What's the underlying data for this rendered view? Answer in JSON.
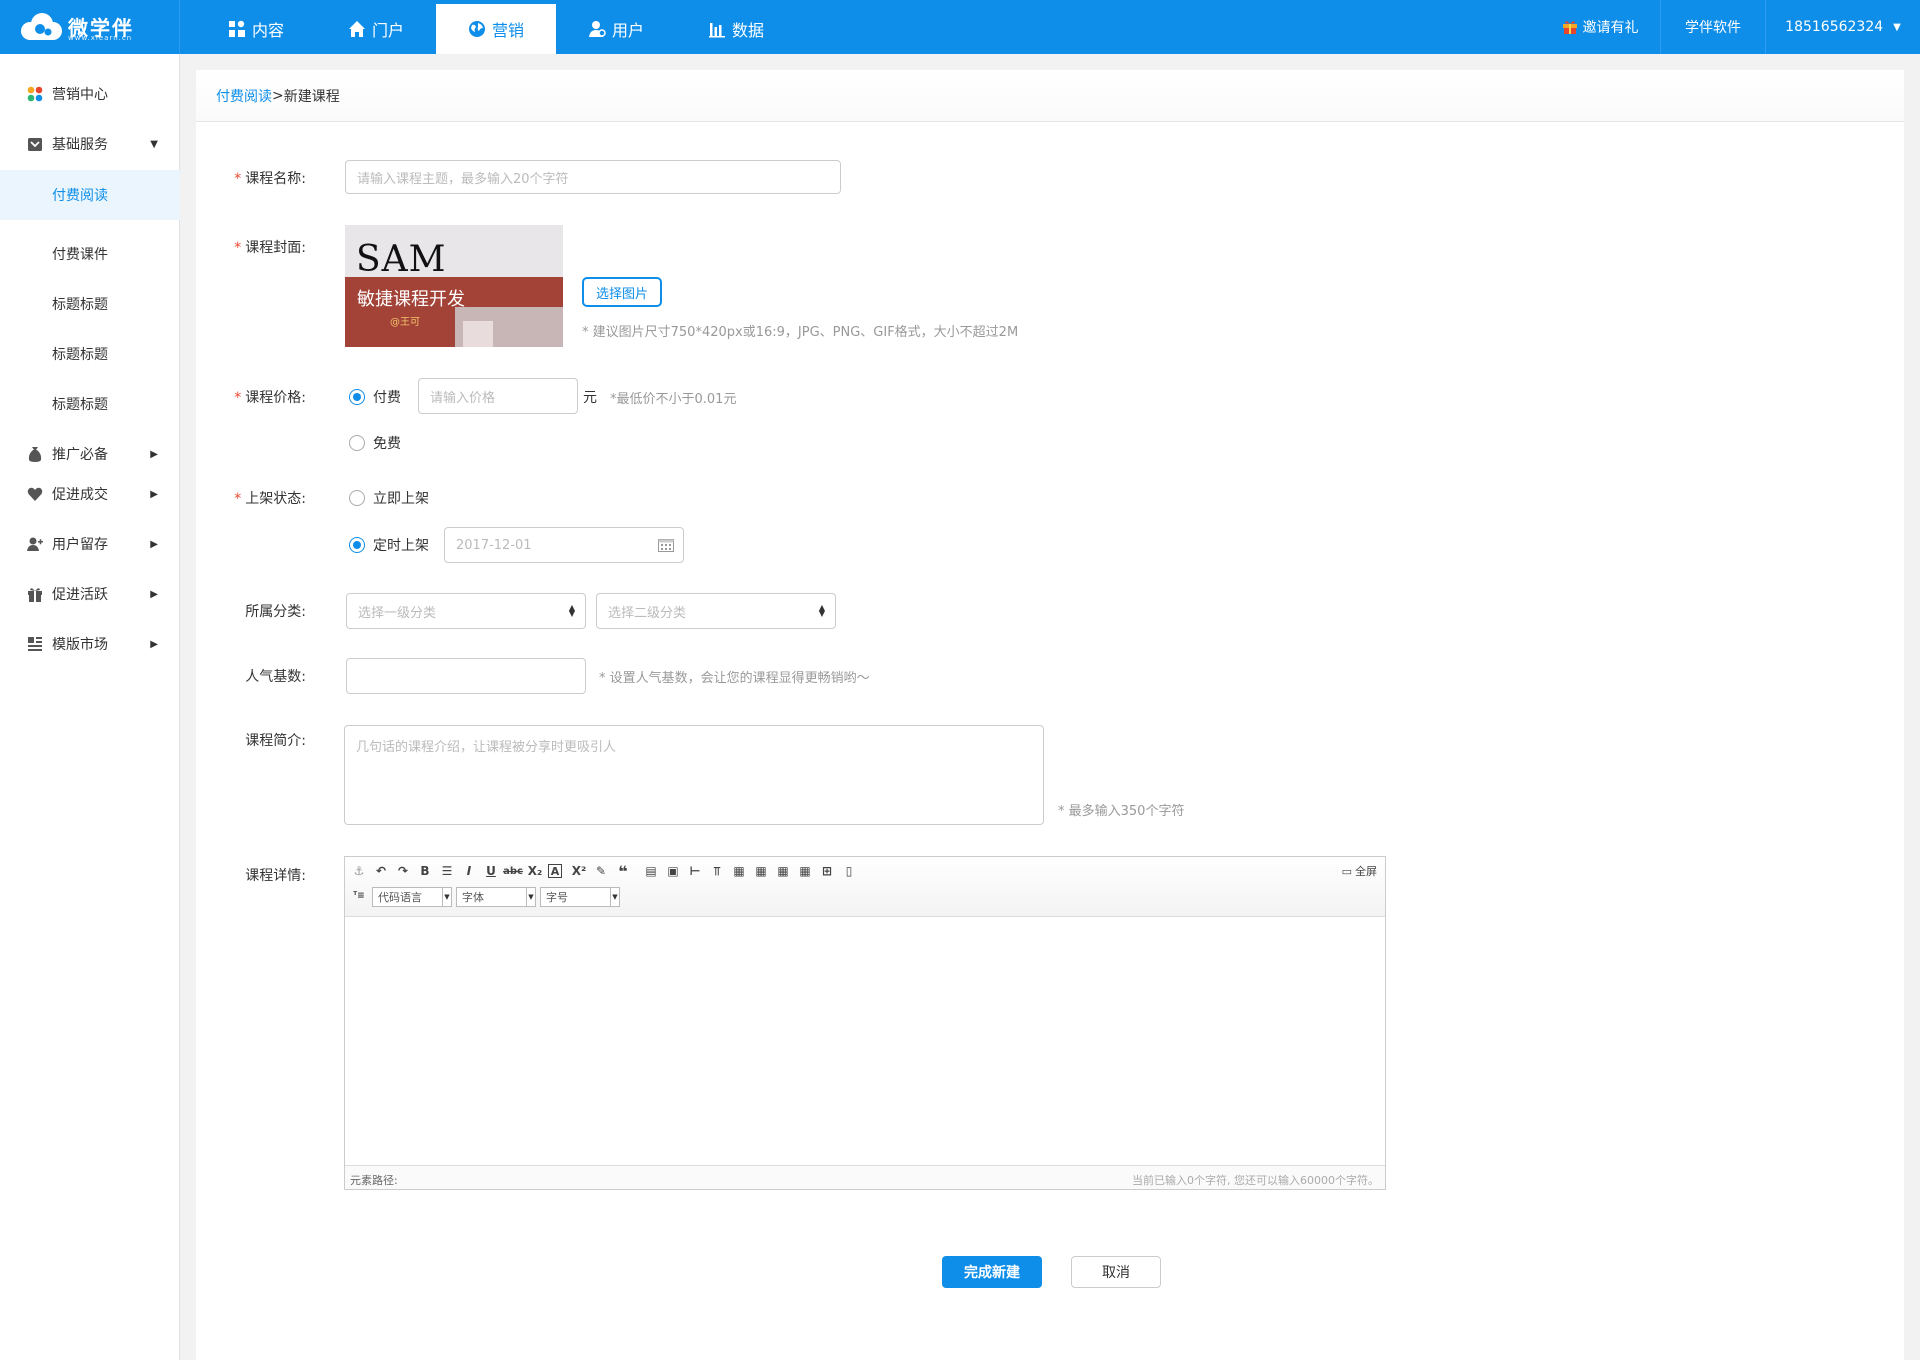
{
  "brand": {
    "name": "微学伴",
    "domain": "www.xlearn.cn",
    "color": "#0e8ee9"
  },
  "nav": {
    "tabs": [
      {
        "label": "内容",
        "icon": "grid-icon"
      },
      {
        "label": "门户",
        "icon": "home-icon"
      },
      {
        "label": "营销",
        "icon": "globe-icon",
        "active": true
      },
      {
        "label": "用户",
        "icon": "user-icon"
      },
      {
        "label": "数据",
        "icon": "bar-chart-icon"
      }
    ],
    "invite": "邀请有礼",
    "software": "学伴软件",
    "account": "18516562324"
  },
  "sidebar": {
    "items": [
      {
        "label": "营销中心",
        "icon": "colorful-dots-icon"
      },
      {
        "label": "基础服务",
        "icon": "box-icon",
        "expanded": true
      },
      {
        "label": "付费阅读",
        "sub": true,
        "active": true
      },
      {
        "label": "付费课件",
        "sub": true
      },
      {
        "label": "标题标题",
        "sub": true
      },
      {
        "label": "标题标题",
        "sub": true
      },
      {
        "label": "标题标题",
        "sub": true
      },
      {
        "label": "推广必备",
        "icon": "bag-icon"
      },
      {
        "label": "促进成交",
        "icon": "heart-icon"
      },
      {
        "label": "用户留存",
        "icon": "user-add-icon"
      },
      {
        "label": "促进活跃",
        "icon": "gift-icon"
      },
      {
        "label": "模版市场",
        "icon": "template-icon"
      }
    ]
  },
  "breadcrumb": {
    "parent": "付费阅读",
    "separator": ">",
    "current": "新建课程"
  },
  "form": {
    "name": {
      "label": "课程名称:",
      "placeholder": "请输入课程主题，最多输入20个字符"
    },
    "cover": {
      "label": "课程封面:",
      "image_title": "SAM",
      "image_subtitle": "敏捷课程开发",
      "image_author": "@王可",
      "choose_button": "选择图片",
      "hint": "* 建议图片尺寸750*420px或16:9，JPG、PNG、GIF格式，大小不超过2M"
    },
    "price": {
      "label": "课程价格:",
      "paid": "付费",
      "free": "免费",
      "placeholder": "请输入价格",
      "unit": "元",
      "hint": "*最低价不小于0.01元",
      "selected": "paid"
    },
    "shelf": {
      "label": "上架状态:",
      "now": "立即上架",
      "scheduled": "定时上架",
      "date_placeholder": "2017-12-01",
      "selected": "scheduled"
    },
    "category": {
      "label": "所属分类:",
      "level1": "选择一级分类",
      "level2": "选择二级分类"
    },
    "popularity": {
      "label": "人气基数:",
      "value": "",
      "hint": "* 设置人气基数，会让您的课程显得更畅销哟～"
    },
    "intro": {
      "label": "课程简介:",
      "placeholder": "几句话的课程介绍，让课程被分享时更吸引人",
      "hint": "* 最多输入350个字符"
    },
    "detail": {
      "label": "课程详情:",
      "fullscreen": "全屏",
      "code_lang": "代码语言",
      "font": "字体",
      "font_size": "字号",
      "path_label": "元素路径:",
      "counter": "当前已输入0个字符, 您还可以输入60000个字符。"
    }
  },
  "actions": {
    "submit": "完成新建",
    "cancel": "取消"
  }
}
